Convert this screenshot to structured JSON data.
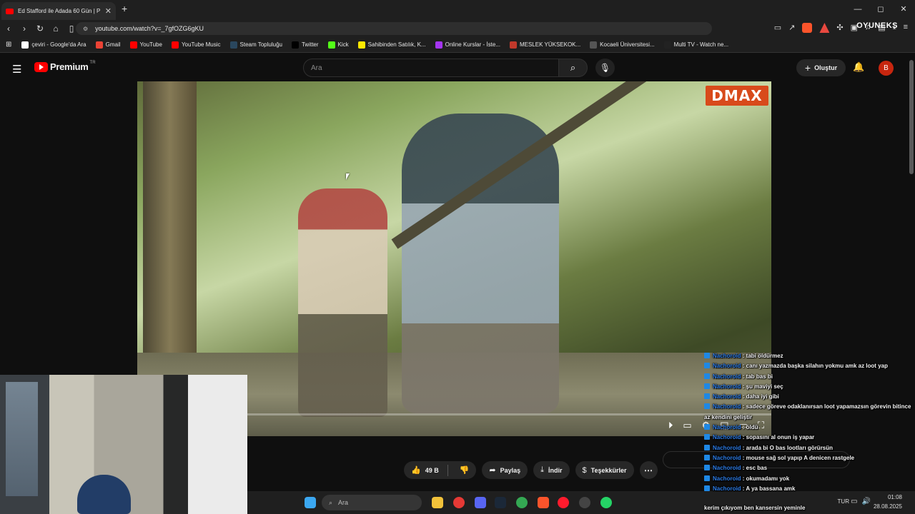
{
  "browser": {
    "tab_title": "Ed Stafford ile Adada 60 Gün | P",
    "new_tab": "+",
    "url": "youtube.com/watch?v=_7gfOZG6gKU",
    "overlay_logo": "OYUNEKS",
    "window_controls": [
      "—",
      "◻",
      "✕"
    ]
  },
  "bookmarks": [
    {
      "label": "çeviri - Google'da Ara",
      "icon": "google-icon",
      "color": "#ffffff"
    },
    {
      "label": "Gmail",
      "icon": "gmail-icon",
      "color": "#ea4335"
    },
    {
      "label": "YouTube",
      "icon": "youtube-icon",
      "color": "#ff0000"
    },
    {
      "label": "YouTube Music",
      "icon": "youtube-music-icon",
      "color": "#ff0000"
    },
    {
      "label": "Steam Topluluğu",
      "icon": "steam-icon",
      "color": "#2a475e"
    },
    {
      "label": "Twitter",
      "icon": "x-icon",
      "color": "#000000"
    },
    {
      "label": "Kick",
      "icon": "kick-icon",
      "color": "#53fc18"
    },
    {
      "label": "Sahibinden Satılık, K...",
      "icon": "sahibinden-icon",
      "color": "#ffe800"
    },
    {
      "label": "Online Kurslar - İste...",
      "icon": "udemy-icon",
      "color": "#a435f0"
    },
    {
      "label": "MESLEK YÜKSEKOK...",
      "icon": "school-icon",
      "color": "#c0392b"
    },
    {
      "label": "Kocaeli Üniversitesi...",
      "icon": "kou-icon",
      "color": "#555555"
    },
    {
      "label": "Multi TV - Watch ne...",
      "icon": "tv-icon",
      "color": "#222222"
    }
  ],
  "youtube": {
    "logo_text": "Premium",
    "region": "TR",
    "search_placeholder": "Ara",
    "create_label": "Oluştur",
    "avatar_letter": "B"
  },
  "video": {
    "channel_watermark": "DMAX"
  },
  "actions": {
    "likes": "49 B",
    "share": "Paylaş",
    "download": "İndir",
    "thanks": "Teşekkürler"
  },
  "chat": [
    {
      "name": "Nachoroid",
      "text": "tabi öldürmez"
    },
    {
      "name": "Nachoroid",
      "text": "canı yazmazda başka silahın yokmu amk az loot yap"
    },
    {
      "name": "Nachoroid",
      "text": "tab bas bi"
    },
    {
      "name": "Nachoroid",
      "text": "şu maviyi seç"
    },
    {
      "name": "Nachoroid",
      "text": "daha iyi gibi"
    },
    {
      "name": "Nachoroid",
      "text": "sadece göreve odaklanırsan loot yapamazsın görevin bitince az kendini geliştir"
    },
    {
      "name": "Nachoroid",
      "text": "öldü"
    },
    {
      "name": "Nachoroid",
      "text": "sopasını al onun iş yapar"
    },
    {
      "name": "Nachoroid",
      "text": "arada bi O bas lootları görürsün"
    },
    {
      "name": "Nachoroid",
      "text": "mouse sağ sol yapıp A denicen rastgele"
    },
    {
      "name": "Nachoroid",
      "text": "esc bas"
    },
    {
      "name": "Nachoroid",
      "text": "okumadamı yok"
    },
    {
      "name": "Nachoroid",
      "text": "A ya bassana amk"
    }
  ],
  "chat_tail": "kerim çıkıyom ben kansersin yeminle",
  "taskbar": {
    "search_placeholder": "Ara",
    "language": "TUR",
    "time": "01:08",
    "date": "28.08.2025"
  }
}
